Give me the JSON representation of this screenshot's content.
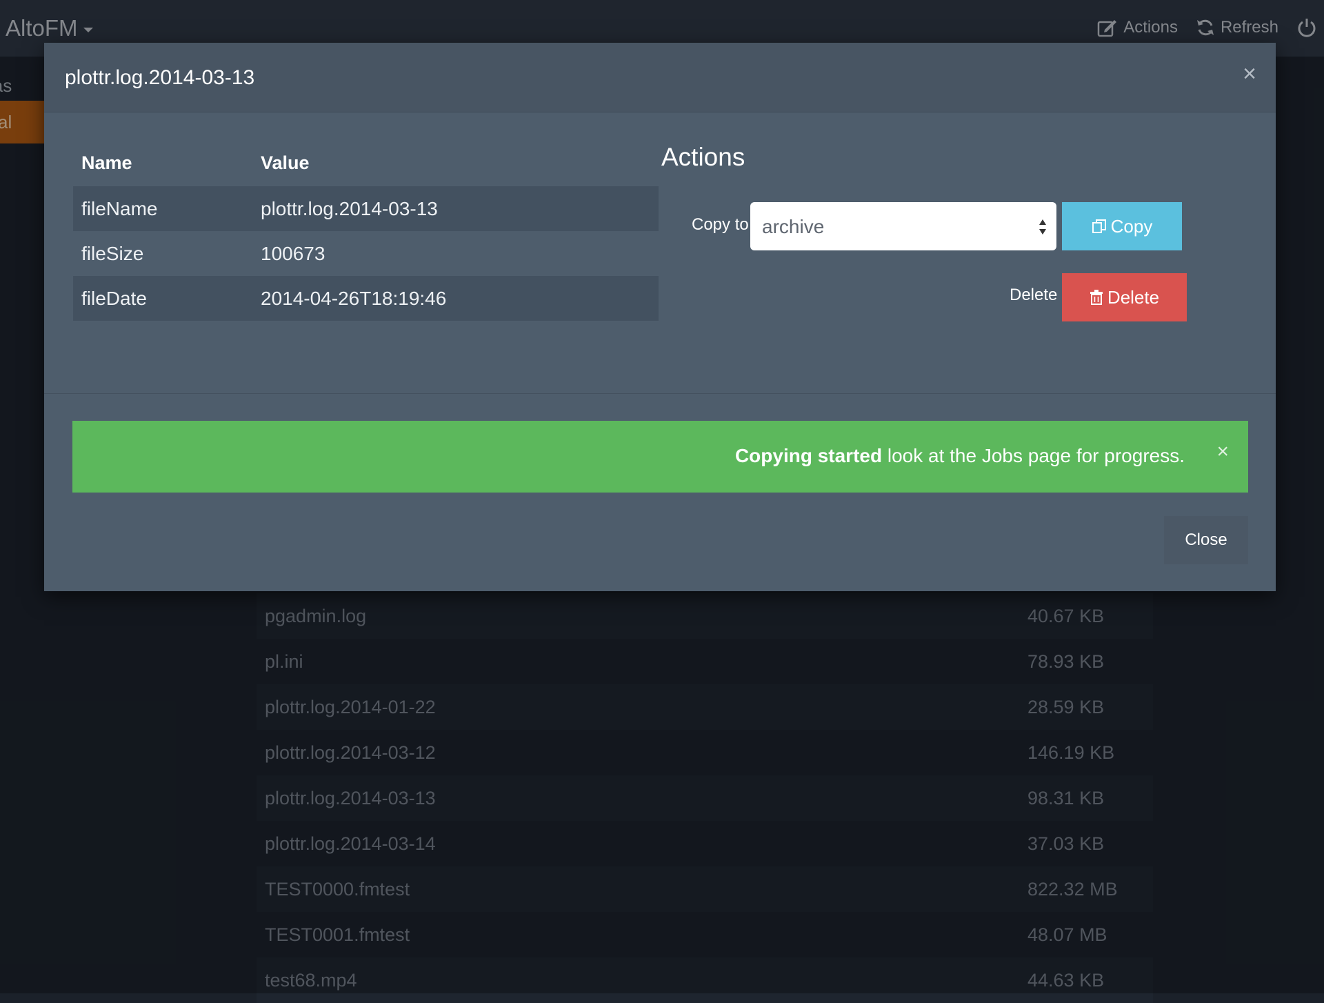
{
  "navbar": {
    "brand": "AltoFM",
    "actions_label": "Actions",
    "refresh_label": "Refresh"
  },
  "sidebar": {
    "items": [
      {
        "label": "ias"
      },
      {
        "label": "cal"
      }
    ]
  },
  "files": [
    {
      "name": "pgadmin.log",
      "size": "40.67 KB"
    },
    {
      "name": "pl.ini",
      "size": "78.93 KB"
    },
    {
      "name": "plottr.log.2014-01-22",
      "size": "28.59 KB"
    },
    {
      "name": "plottr.log.2014-03-12",
      "size": "146.19 KB"
    },
    {
      "name": "plottr.log.2014-03-13",
      "size": "98.31 KB"
    },
    {
      "name": "plottr.log.2014-03-14",
      "size": "37.03 KB"
    },
    {
      "name": "TEST0000.fmtest",
      "size": "822.32 MB"
    },
    {
      "name": "TEST0001.fmtest",
      "size": "48.07 MB"
    },
    {
      "name": "test68.mp4",
      "size": "44.63 KB"
    }
  ],
  "modal": {
    "title": "plottr.log.2014-03-13",
    "close_symbol": "×",
    "table": {
      "headers": [
        "Name",
        "Value"
      ],
      "rows": [
        {
          "name": "fileName",
          "value": "plottr.log.2014-03-13"
        },
        {
          "name": "fileSize",
          "value": "100673"
        },
        {
          "name": "fileDate",
          "value": "2014-04-26T18:19:46"
        }
      ]
    },
    "actions": {
      "title": "Actions",
      "copy_to_label": "Copy to",
      "copy_target": "archive",
      "copy_button": "Copy",
      "delete_label": "Delete",
      "delete_button": "Delete"
    },
    "alert": {
      "strong": "Copying started",
      "text": " look at the Jobs page for progress.",
      "close_symbol": "×",
      "color": "#5cb85c"
    },
    "close_button": "Close"
  },
  "colors": {
    "copy_button": "#5bc0de",
    "delete_button": "#d9534f",
    "sidebar_active": "#a85712"
  }
}
